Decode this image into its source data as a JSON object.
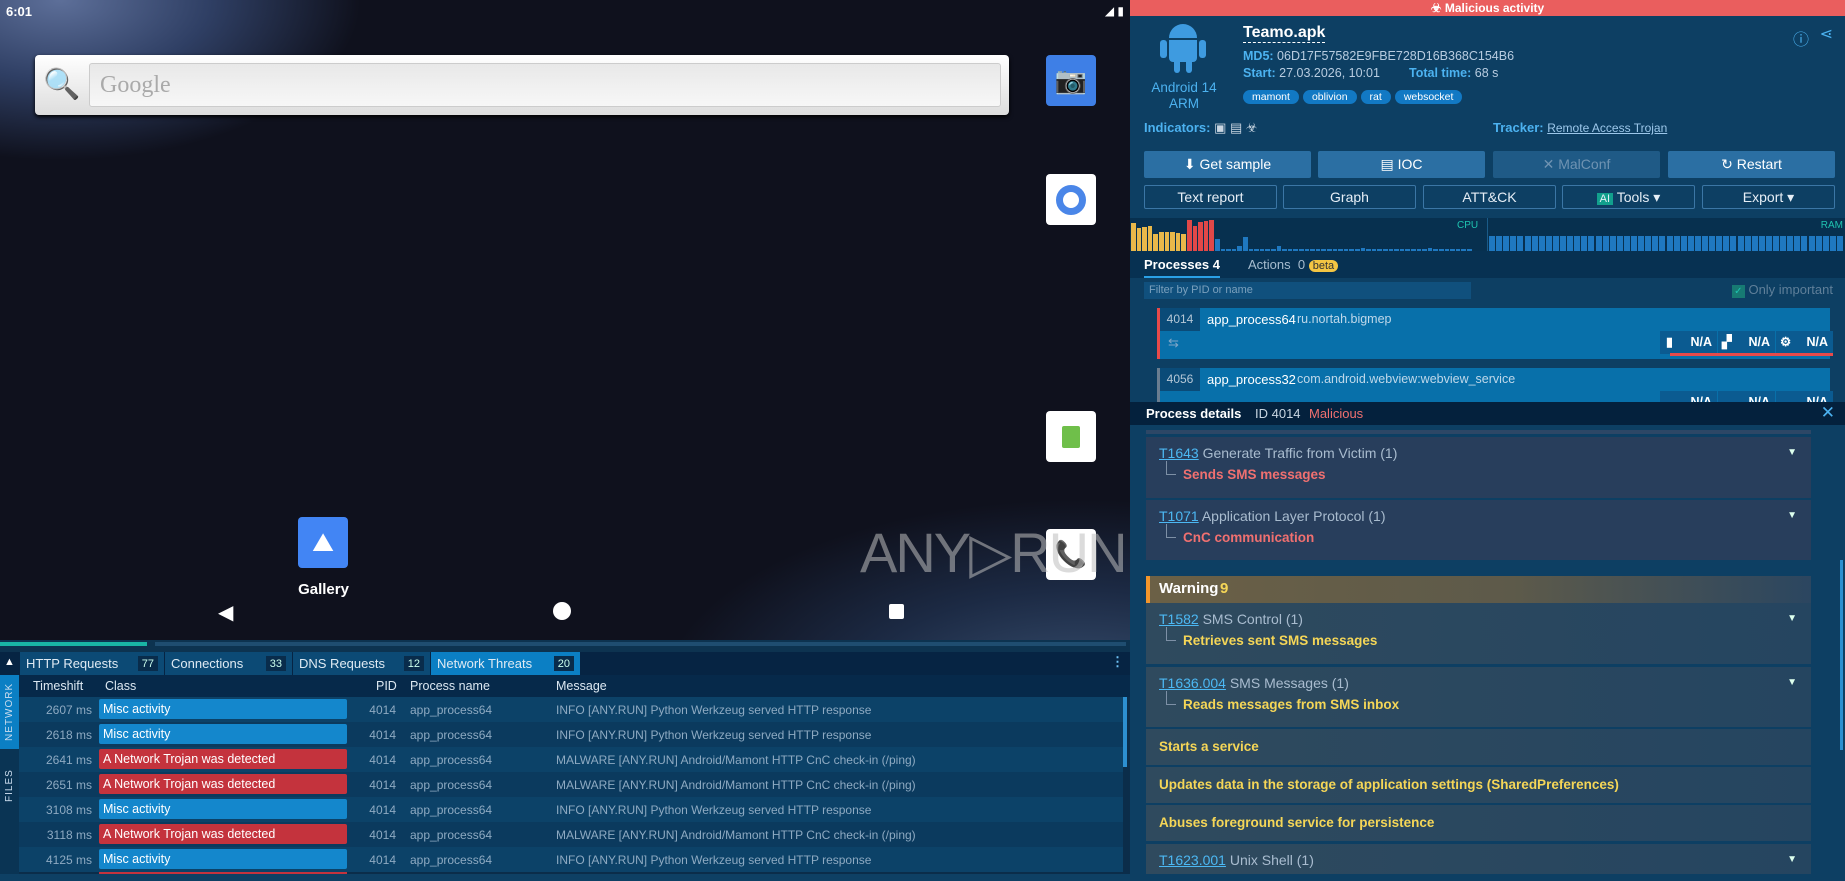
{
  "emulator": {
    "time": "6:01",
    "search_placeholder": "Google",
    "gallery_label": "Gallery",
    "watermark": "ANY▷RUN"
  },
  "network": {
    "tabs": [
      {
        "label": "HTTP Requests",
        "count": "77"
      },
      {
        "label": "Connections",
        "count": "33"
      },
      {
        "label": "DNS Requests",
        "count": "12"
      },
      {
        "label": "Network Threats",
        "count": "20"
      }
    ],
    "side_tabs": [
      "NETWORK",
      "FILES"
    ],
    "columns": [
      "Timeshift",
      "Class",
      "PID",
      "Process name",
      "Message"
    ],
    "rows": [
      {
        "time": "2607 ms",
        "class": "Misc activity",
        "severity": "info",
        "pid": "4014",
        "process": "app_process64",
        "message": "INFO [ANY.RUN] Python Werkzeug served HTTP response"
      },
      {
        "time": "2618 ms",
        "class": "Misc activity",
        "severity": "info",
        "pid": "4014",
        "process": "app_process64",
        "message": "INFO [ANY.RUN] Python Werkzeug served HTTP response"
      },
      {
        "time": "2641 ms",
        "class": "A Network Trojan was detected",
        "severity": "malicious",
        "pid": "4014",
        "process": "app_process64",
        "message": "MALWARE [ANY.RUN] Android/Mamont HTTP CnC check-in (/ping)"
      },
      {
        "time": "2651 ms",
        "class": "A Network Trojan was detected",
        "severity": "malicious",
        "pid": "4014",
        "process": "app_process64",
        "message": "MALWARE [ANY.RUN] Android/Mamont HTTP CnC check-in (/ping)"
      },
      {
        "time": "3108 ms",
        "class": "Misc activity",
        "severity": "info",
        "pid": "4014",
        "process": "app_process64",
        "message": "INFO [ANY.RUN] Python Werkzeug served HTTP response"
      },
      {
        "time": "3118 ms",
        "class": "A Network Trojan was detected",
        "severity": "malicious",
        "pid": "4014",
        "process": "app_process64",
        "message": "MALWARE [ANY.RUN] Android/Mamont HTTP CnC check-in (/ping)"
      },
      {
        "time": "4125 ms",
        "class": "Misc activity",
        "severity": "info",
        "pid": "4014",
        "process": "app_process64",
        "message": "INFO [ANY.RUN] Python Werkzeug served HTTP response"
      }
    ],
    "progress_percent": 13
  },
  "report": {
    "banner": "Malicious activity",
    "os": "Android 14",
    "arch": "ARM",
    "filename": "Teamo.apk",
    "md5_label": "MD5:",
    "md5": "06D17F57582E9FBE728D16B368C154B6",
    "start_label": "Start:",
    "start": "27.03.2026, 10:01",
    "total_label": "Total time:",
    "total": "68 s",
    "tags": [
      "mamont",
      "oblivion",
      "rat",
      "websocket"
    ],
    "indicators_label": "Indicators:",
    "tracker_label": "Tracker:",
    "tracker": "Remote Access Trojan",
    "buttons1": [
      "Get sample",
      "IOC",
      "MalConf",
      "Restart"
    ],
    "buttons2": [
      "Text report",
      "Graph",
      "ATT&CK",
      "Tools",
      "Export"
    ],
    "ai_badge": "AI",
    "cpu_label": "CPU",
    "ram_label": "RAM",
    "cpu_levels": [
      0.9,
      0.75,
      0.78,
      0.82,
      0.55,
      0.6,
      0.6,
      0.6,
      0.58,
      0.55,
      1.0,
      0.8,
      0.95,
      0.98,
      1.0,
      0.4,
      0.05,
      0.05,
      0.05,
      0.15,
      0.45,
      0.05,
      0.05,
      0.05,
      0.05,
      0.05,
      0.15,
      0.05,
      0.05,
      0.05,
      0.05,
      0.05,
      0.05,
      0.05,
      0.05,
      0.05,
      0.05,
      0.08,
      0.05,
      0.05,
      0.05,
      0.1,
      0.05,
      0.05,
      0.05,
      0.05,
      0.05,
      0.08,
      0.05,
      0.05,
      0.08,
      0.05,
      0.05,
      0.1,
      0.05,
      0.05,
      0.05,
      0.05,
      0.05,
      0.05,
      0.05
    ],
    "ram_levels_percent": 45,
    "colors": {
      "banner": "#ea5e5e",
      "malicious": "#f07070",
      "warning": "#f5d657",
      "info": "#1487cc",
      "trojan": "#c4333d",
      "accent": "#4cb2f0"
    },
    "processes_tab": "Processes",
    "processes_count": "4",
    "actions_tab": "Actions",
    "actions_count": "0",
    "beta": "beta",
    "filter_placeholder": "Filter by PID or name",
    "only_important": "Only important",
    "processes": [
      {
        "pid": "4014",
        "name": "app_process64",
        "cmd": "ru.nortah.bigmep",
        "na": [
          "N/A",
          "N/A",
          "N/A"
        ]
      },
      {
        "pid": "4056",
        "name": "app_process32",
        "cmd": "com.android.webview:webview_service",
        "na": [
          "N/A",
          "N/A",
          "N/A"
        ]
      }
    ],
    "details": {
      "title": "Process details",
      "id": "ID 4014",
      "verdict": "Malicious"
    },
    "malicious_items": [
      {
        "id": "T1643",
        "name": "Generate Traffic from Victim (1)",
        "sub": "Sends SMS messages"
      },
      {
        "id": "T1071",
        "name": "Application Layer Protocol (1)",
        "sub": "CnC communication"
      }
    ],
    "warning_label": "Warning",
    "warning_count": "9",
    "warning_items": [
      {
        "id": "T1582",
        "name": "SMS Control (1)",
        "sub": "Retrieves sent SMS messages"
      },
      {
        "id": "T1636.004",
        "name": "SMS Messages (1)",
        "sub": "Reads messages from SMS inbox"
      },
      {
        "text": "Starts a service"
      },
      {
        "text": "Updates data in the storage of application settings (SharedPreferences)"
      },
      {
        "text": "Abuses foreground service for persistence"
      },
      {
        "id": "T1623.001",
        "name": "Unix Shell (1)"
      }
    ]
  }
}
